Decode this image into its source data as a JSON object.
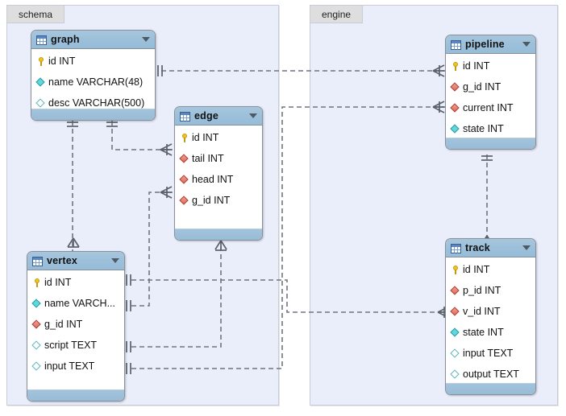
{
  "diagram": {
    "title": "database-schema-er-diagram",
    "background_color": "#ffffff",
    "panel_color": "#eaedfa",
    "header_color": "#9dc0da"
  },
  "panels": [
    {
      "id": "schema",
      "label": "schema"
    },
    {
      "id": "engine",
      "label": "engine"
    }
  ],
  "tables": [
    {
      "id": "graph",
      "name": "graph",
      "icon": "table-icon",
      "caret": "chevron-down-icon",
      "columns": [
        {
          "name": "id INT",
          "glyph": "key-icon"
        },
        {
          "name": "name VARCHAR(48)",
          "glyph": "diamond-cyan-icon"
        },
        {
          "name": "desc VARCHAR(500)",
          "glyph": "diamond-hollow-icon"
        }
      ]
    },
    {
      "id": "edge",
      "name": "edge",
      "icon": "table-icon",
      "caret": "chevron-down-icon",
      "columns": [
        {
          "name": "id INT",
          "glyph": "key-icon"
        },
        {
          "name": "tail INT",
          "glyph": "diamond-red-icon"
        },
        {
          "name": "head INT",
          "glyph": "diamond-red-icon"
        },
        {
          "name": "g_id INT",
          "glyph": "diamond-red-icon"
        }
      ]
    },
    {
      "id": "vertex",
      "name": "vertex",
      "icon": "table-icon",
      "caret": "chevron-down-icon",
      "columns": [
        {
          "name": "id INT",
          "glyph": "key-icon"
        },
        {
          "name": "name VARCH...",
          "glyph": "diamond-cyan-icon"
        },
        {
          "name": "g_id INT",
          "glyph": "diamond-red-icon"
        },
        {
          "name": "script TEXT",
          "glyph": "diamond-hollow-icon"
        },
        {
          "name": "input TEXT",
          "glyph": "diamond-hollow-icon"
        }
      ]
    },
    {
      "id": "pipeline",
      "name": "pipeline",
      "icon": "table-icon",
      "caret": "chevron-down-icon",
      "columns": [
        {
          "name": "id INT",
          "glyph": "key-icon"
        },
        {
          "name": "g_id INT",
          "glyph": "diamond-red-icon"
        },
        {
          "name": "current INT",
          "glyph": "diamond-red-icon"
        },
        {
          "name": "state INT",
          "glyph": "diamond-cyan-icon"
        }
      ]
    },
    {
      "id": "track",
      "name": "track",
      "icon": "table-icon",
      "caret": "chevron-down-icon",
      "columns": [
        {
          "name": "id INT",
          "glyph": "key-icon"
        },
        {
          "name": "p_id INT",
          "glyph": "diamond-red-icon"
        },
        {
          "name": "v_id INT",
          "glyph": "diamond-red-icon"
        },
        {
          "name": "state INT",
          "glyph": "diamond-cyan-icon"
        },
        {
          "name": "input TEXT",
          "glyph": "diamond-hollow-icon"
        },
        {
          "name": "output TEXT",
          "glyph": "diamond-hollow-icon"
        }
      ]
    }
  ],
  "relationships": [
    {
      "id": "graph-pipeline",
      "from": "graph",
      "to": "pipeline",
      "from_card": "one",
      "to_card": "many"
    },
    {
      "id": "graph-edge",
      "from": "graph",
      "to": "edge",
      "from_card": "one",
      "to_card": "many"
    },
    {
      "id": "graph-vertex",
      "from": "graph",
      "to": "vertex",
      "from_card": "one",
      "to_card": "many"
    },
    {
      "id": "vertex-edge-tail",
      "from": "vertex",
      "to": "edge",
      "from_card": "one",
      "to_card": "many"
    },
    {
      "id": "vertex-edge-head",
      "from": "vertex",
      "to": "edge",
      "from_card": "one",
      "to_card": "many"
    },
    {
      "id": "pipeline-track",
      "from": "pipeline",
      "to": "track",
      "from_card": "one",
      "to_card": "many"
    },
    {
      "id": "vertex-track",
      "from": "vertex",
      "to": "track",
      "from_card": "one",
      "to_card": "many"
    }
  ]
}
